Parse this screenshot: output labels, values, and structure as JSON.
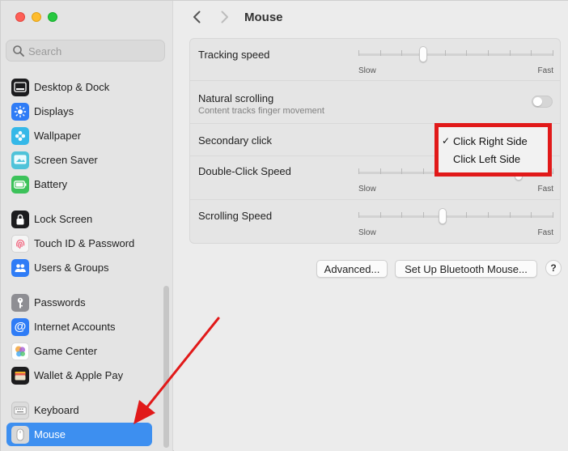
{
  "window": {
    "title": "Mouse"
  },
  "search": {
    "placeholder": "Search"
  },
  "sidebar": {
    "items": [
      {
        "label": "Desktop & Dock",
        "icon": "desktop-dock-icon",
        "color": "#1c1c1e"
      },
      {
        "label": "Displays",
        "icon": "displays-icon",
        "color": "#2f7cf6"
      },
      {
        "label": "Wallpaper",
        "icon": "wallpaper-icon",
        "color": "#35b8e8"
      },
      {
        "label": "Screen Saver",
        "icon": "screen-saver-icon",
        "color": "#4fc3d9"
      },
      {
        "label": "Battery",
        "icon": "battery-icon",
        "color": "#3cc25a"
      },
      {
        "label": "Lock Screen",
        "icon": "lock-screen-icon",
        "color": "#1c1c1e"
      },
      {
        "label": "Touch ID & Password",
        "icon": "fingerprint-icon",
        "color": "#f5f5f5"
      },
      {
        "label": "Users & Groups",
        "icon": "users-groups-icon",
        "color": "#2f7cf6"
      },
      {
        "label": "Passwords",
        "icon": "key-icon",
        "color": "#8e8e93"
      },
      {
        "label": "Internet Accounts",
        "icon": "at-sign-icon",
        "color": "#2f7cf6"
      },
      {
        "label": "Game Center",
        "icon": "game-center-icon",
        "color": "#ffffff"
      },
      {
        "label": "Wallet & Apple Pay",
        "icon": "wallet-icon",
        "color": "#1c1c1e"
      },
      {
        "label": "Keyboard",
        "icon": "keyboard-icon",
        "color": "#dcdcdc"
      },
      {
        "label": "Mouse",
        "icon": "mouse-icon",
        "color": "#d8d8d8",
        "selected": true
      }
    ]
  },
  "settings": {
    "tracking": {
      "label": "Tracking speed",
      "min_label": "Slow",
      "max_label": "Fast",
      "value": 0.33
    },
    "natural": {
      "label": "Natural scrolling",
      "sublabel": "Content tracks finger movement",
      "enabled": false
    },
    "secondary": {
      "label": "Secondary click"
    },
    "double_click": {
      "label": "Double-Click Speed",
      "min_label": "Slow",
      "max_label": "Fast",
      "value": 0.82
    },
    "scrolling": {
      "label": "Scrolling Speed",
      "min_label": "Slow",
      "max_label": "Fast",
      "value": 0.43
    }
  },
  "secondary_menu": {
    "options": [
      {
        "label": "Click Right Side",
        "checked": true
      },
      {
        "label": "Click Left Side",
        "checked": false
      }
    ],
    "check_glyph": "✓",
    "highlight_color": "#e11919"
  },
  "buttons": {
    "advanced": "Advanced...",
    "bluetooth": "Set Up Bluetooth Mouse...",
    "help": "?"
  },
  "annotation": {
    "arrow_color": "#e11919"
  }
}
